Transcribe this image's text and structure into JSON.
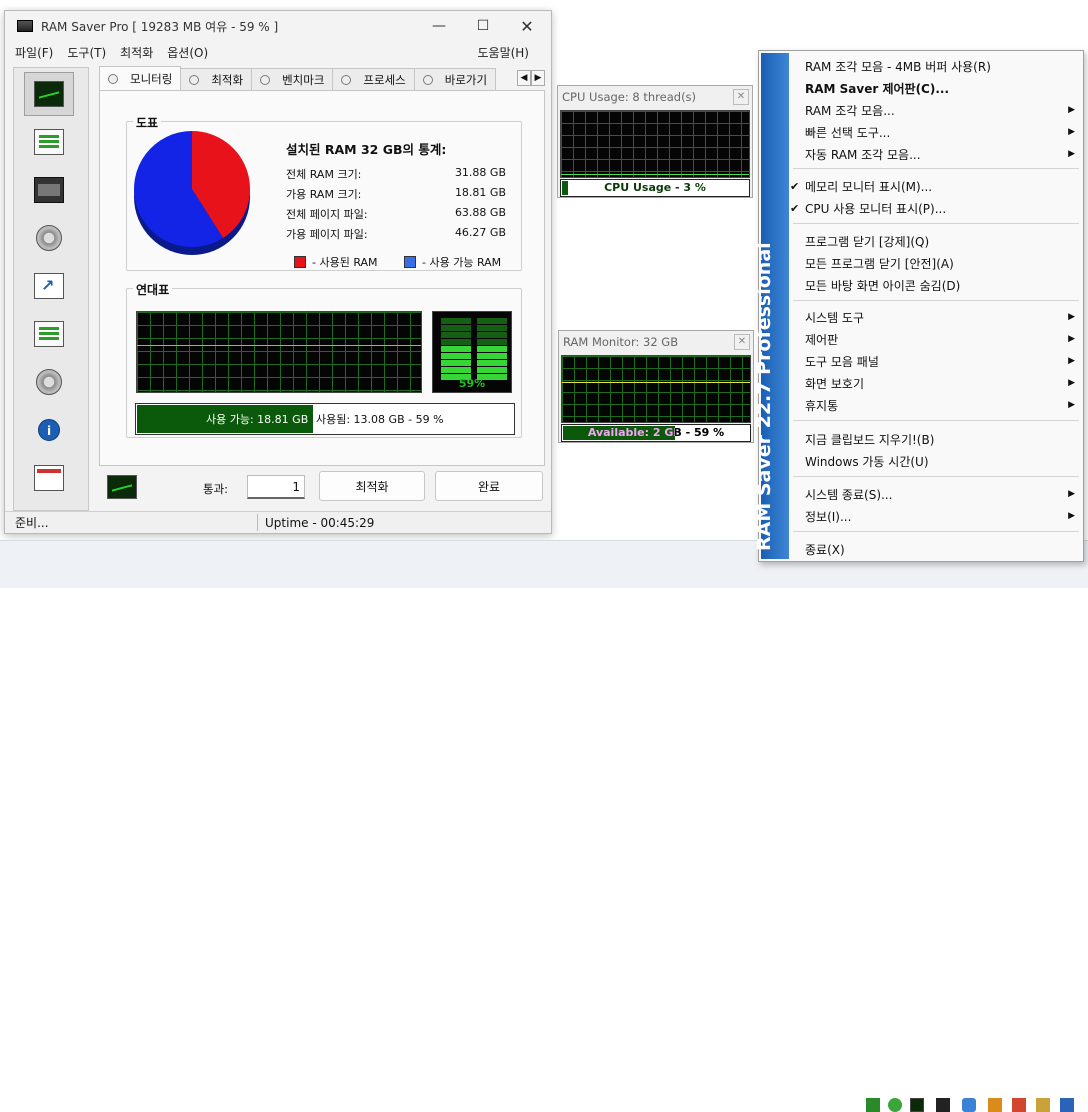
{
  "main": {
    "title": "RAM Saver Pro [ 19283 MB 여유 - 59 % ]",
    "menu": [
      "파일(F)",
      "도구(T)",
      "최적화",
      "옵션(O)"
    ],
    "help": "도움말(H)",
    "tabs": [
      "모니터링",
      "최적화",
      "벤치마크",
      "프로세스",
      "바로가기"
    ],
    "chart_group": "도표",
    "stats_title": "설치된 RAM 32 GB의 통계:",
    "stats": [
      {
        "label": "전체 RAM 크기:",
        "value": "31.88 GB"
      },
      {
        "label": "가용 RAM 크기:",
        "value": "18.81 GB"
      },
      {
        "label": "전체 페이지 파일:",
        "value": "63.88 GB"
      },
      {
        "label": "가용 페이지 파일:",
        "value": "46.27 GB"
      }
    ],
    "legend_used": "- 사용된 RAM",
    "legend_free": "- 사용 가능 RAM",
    "history_group": "연대표",
    "bar_percent": "59%",
    "usage_free": "사용 가능: 18.81 GB",
    "usage_used": "사용됨: 13.08 GB - 59 %",
    "pass_label": "통과:",
    "pass_value": "1",
    "optimize_button": "최적화",
    "done_button": "완료",
    "status_left": "준비...",
    "status_uptime": "Uptime - 00:45:29"
  },
  "chart_data": {
    "type": "pie",
    "title": "",
    "categories": [
      "사용된 RAM",
      "사용 가능 RAM"
    ],
    "values": [
      41,
      59
    ],
    "colors": [
      "#e8121b",
      "#1424e6"
    ]
  },
  "cpu_monitor": {
    "title": "CPU Usage: 8 thread(s)",
    "label": "CPU Usage - 3 %",
    "percent": 3
  },
  "ram_monitor": {
    "title": "RAM Monitor: 32 GB",
    "label": "Available: 2 GB - 59 %",
    "percent": 59
  },
  "context_menu": {
    "side_label": "RAM Saver 22.7 Professional",
    "items": [
      {
        "label": "RAM 조각 모음 - 4MB 버퍼 사용(R)"
      },
      {
        "label": "RAM Saver 제어판(C)..."
      },
      {
        "label": "RAM 조각 모음..."
      },
      {
        "label": "빠른 선택 도구..."
      },
      {
        "label": "자동 RAM 조각 모음..."
      },
      {
        "label": "메모리 모니터 표시(M)..."
      },
      {
        "label": "CPU 사용 모니터 표시(P)..."
      },
      {
        "label": "프로그램 닫기 [강제](Q)"
      },
      {
        "label": "모든 프로그램 닫기 [안전](A)"
      },
      {
        "label": "모든 바탕 화면 아이콘 숨김(D)"
      },
      {
        "label": "시스템 도구"
      },
      {
        "label": "제어판"
      },
      {
        "label": "도구 모음 패널"
      },
      {
        "label": "화면 보호기"
      },
      {
        "label": "휴지통"
      },
      {
        "label": "지금 클립보드 지우기!(B)"
      },
      {
        "label": "Windows 가동 시간(U)"
      },
      {
        "label": "시스템 종료(S)..."
      },
      {
        "label": "정보(I)..."
      },
      {
        "label": "종료(X)"
      }
    ]
  },
  "colors": {
    "graph_bg": "#050505",
    "grid": "#1d6b1d",
    "accent_green": "#0b5a0b",
    "menu_side": "#1a5fb4"
  }
}
